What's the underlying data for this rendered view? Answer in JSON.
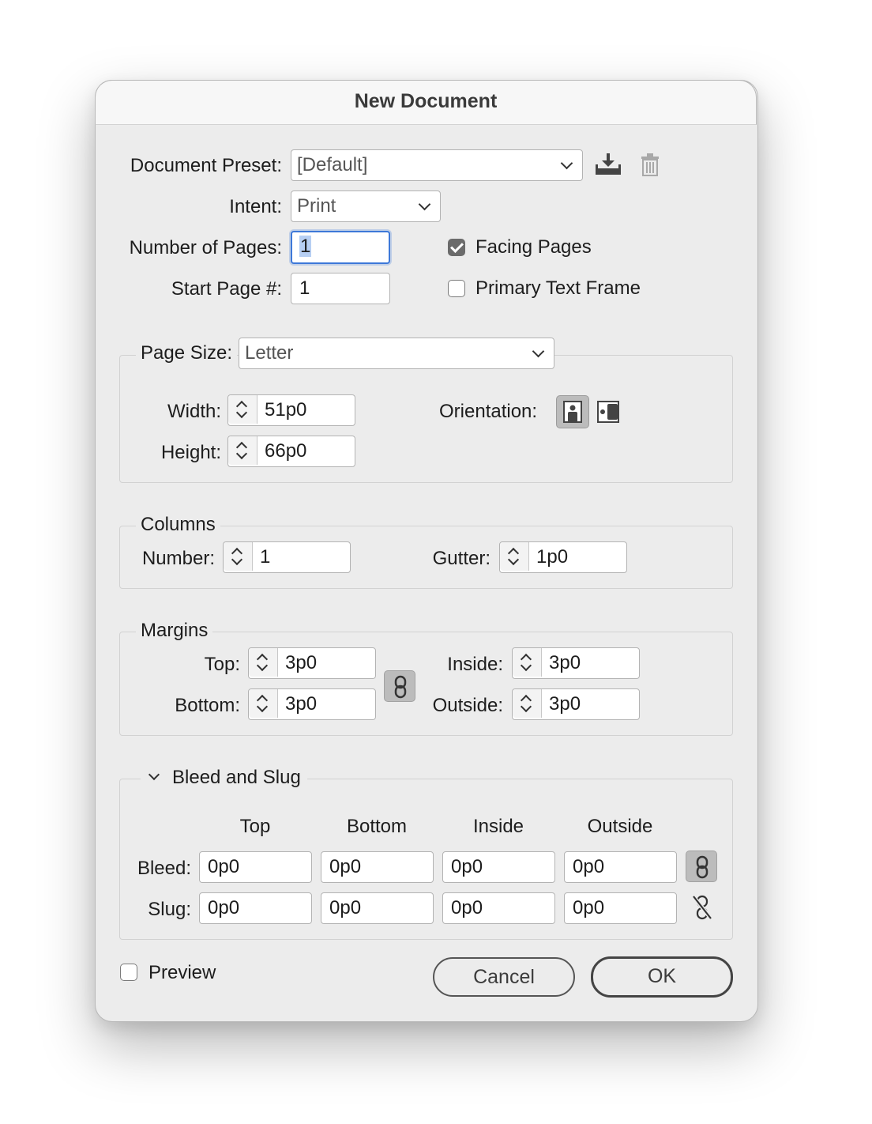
{
  "dialog": {
    "title": "New Document"
  },
  "preset": {
    "label": "Document Preset:",
    "value": "[Default]"
  },
  "intent": {
    "label": "Intent:",
    "value": "Print"
  },
  "pages": {
    "num_label": "Number of Pages:",
    "num_value": "1",
    "start_label": "Start Page #:",
    "start_value": "1",
    "facing_label": "Facing Pages",
    "facing_checked": true,
    "primary_label": "Primary Text Frame",
    "primary_checked": false
  },
  "page_size": {
    "label": "Page Size:",
    "value": "Letter",
    "width_label": "Width:",
    "width_value": "51p0",
    "height_label": "Height:",
    "height_value": "66p0",
    "orientation_label": "Orientation:",
    "orientation_selected": "portrait"
  },
  "columns": {
    "legend": "Columns",
    "number_label": "Number:",
    "number_value": "1",
    "gutter_label": "Gutter:",
    "gutter_value": "1p0"
  },
  "margins": {
    "legend": "Margins",
    "top_label": "Top:",
    "top_value": "3p0",
    "bottom_label": "Bottom:",
    "bottom_value": "3p0",
    "inside_label": "Inside:",
    "inside_value": "3p0",
    "outside_label": "Outside:",
    "outside_value": "3p0"
  },
  "bleed_slug": {
    "legend": "Bleed and Slug",
    "headers": [
      "Top",
      "Bottom",
      "Inside",
      "Outside"
    ],
    "bleed_label": "Bleed:",
    "bleed_values": [
      "0p0",
      "0p0",
      "0p0",
      "0p0"
    ],
    "slug_label": "Slug:",
    "slug_values": [
      "0p0",
      "0p0",
      "0p0",
      "0p0"
    ]
  },
  "footer": {
    "preview_label": "Preview",
    "preview_checked": false,
    "cancel_label": "Cancel",
    "ok_label": "OK"
  },
  "icons": {
    "save_preset": "save-preset-icon",
    "delete_preset": "trash-icon",
    "portrait": "portrait-orientation-icon",
    "landscape": "landscape-orientation-icon",
    "link": "chain-link-icon",
    "unlink": "broken-link-icon",
    "disclosure": "chevron-down-icon"
  },
  "colors": {
    "focus_ring": "#3d78d8",
    "dialog_bg": "#ececec",
    "button_border": "#444444"
  }
}
